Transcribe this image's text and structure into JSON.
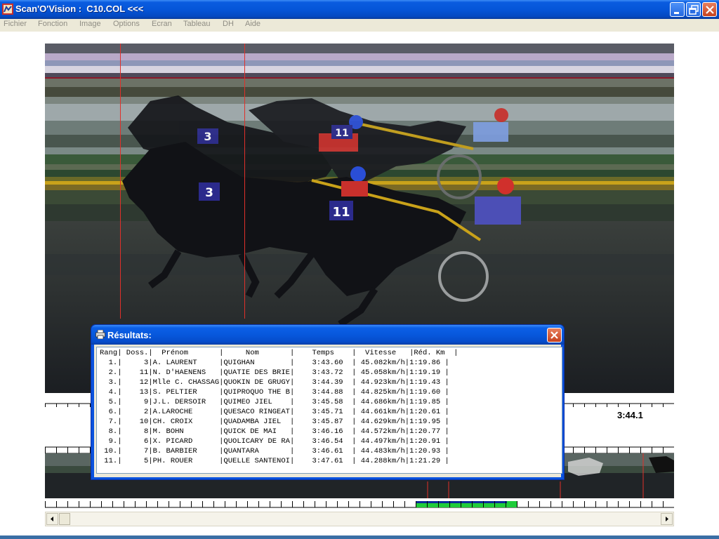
{
  "window": {
    "title": "Scan'O'Vision :  C10.COL <<<",
    "icons": {
      "app": "scanovision-app-icon",
      "minimize": "minimize-icon",
      "maximize": "restore-icon",
      "close": "close-icon"
    }
  },
  "menu": {
    "items": [
      "Fichier",
      "Fonction",
      "Image",
      "Options",
      "Ecran",
      "Tableau",
      "DH",
      "Aide"
    ]
  },
  "timeline": {
    "time_label": "3:44.1"
  },
  "dialog": {
    "title": "Résultats:",
    "icon": "printer-icon",
    "header": "Rang| Doss.|  Prénom       |     Nom       |    Temps    |  Vitesse   |Réd. Km  |",
    "rows": [
      "  1.|     3|A. LAURENT     |QUIGHAN        |    3:43.60  | 45.082km/h|1:19.86 |",
      "  2.|    11|N. D'HAENENS   |QUATIE DES BRIE|    3:43.72  | 45.058km/h|1:19.19 |",
      "  3.|    12|Mlle C. CHASSAG|QUOKIN DE GRUGY|    3:44.39  | 44.923km/h|1:19.43 |",
      "  4.|    13|S. PELTIER     |QUIPROQUO THE B|    3:44.88  | 44.825km/h|1:19.60 |",
      "  5.|     9|J.L. DERSOIR   |QUIMEO JIEL    |    3:45.58  | 44.686km/h|1:19.85 |",
      "  6.|     2|A.LAROCHE      |QUESACO RINGEAT|    3:45.71  | 44.661km/h|1:20.61 |",
      "  7.|    10|CH. CROIX      |QUADAMBA JIEL  |    3:45.87  | 44.629km/h|1:19.95 |",
      "  8.|     8|M. BOHN        |QUICK DE MAI   |    3:46.16  | 44.572km/h|1:20.77 |",
      "  9.|     6|X. PICARD      |QUOLICARY DE RA|    3:46.54  | 44.497km/h|1:20.91 |",
      " 10.|     7|B. BARBIER     |QUANTARA       |    3:46.61  | 44.483km/h|1:20.93 |",
      " 11.|     5|PH. ROUER      |QUELLE SANTENOI|    3:47.61  | 44.288km/h|1:21.29 |"
    ]
  },
  "photo": {
    "saddle_numbers": [
      "3",
      "3",
      "11",
      "11"
    ]
  }
}
